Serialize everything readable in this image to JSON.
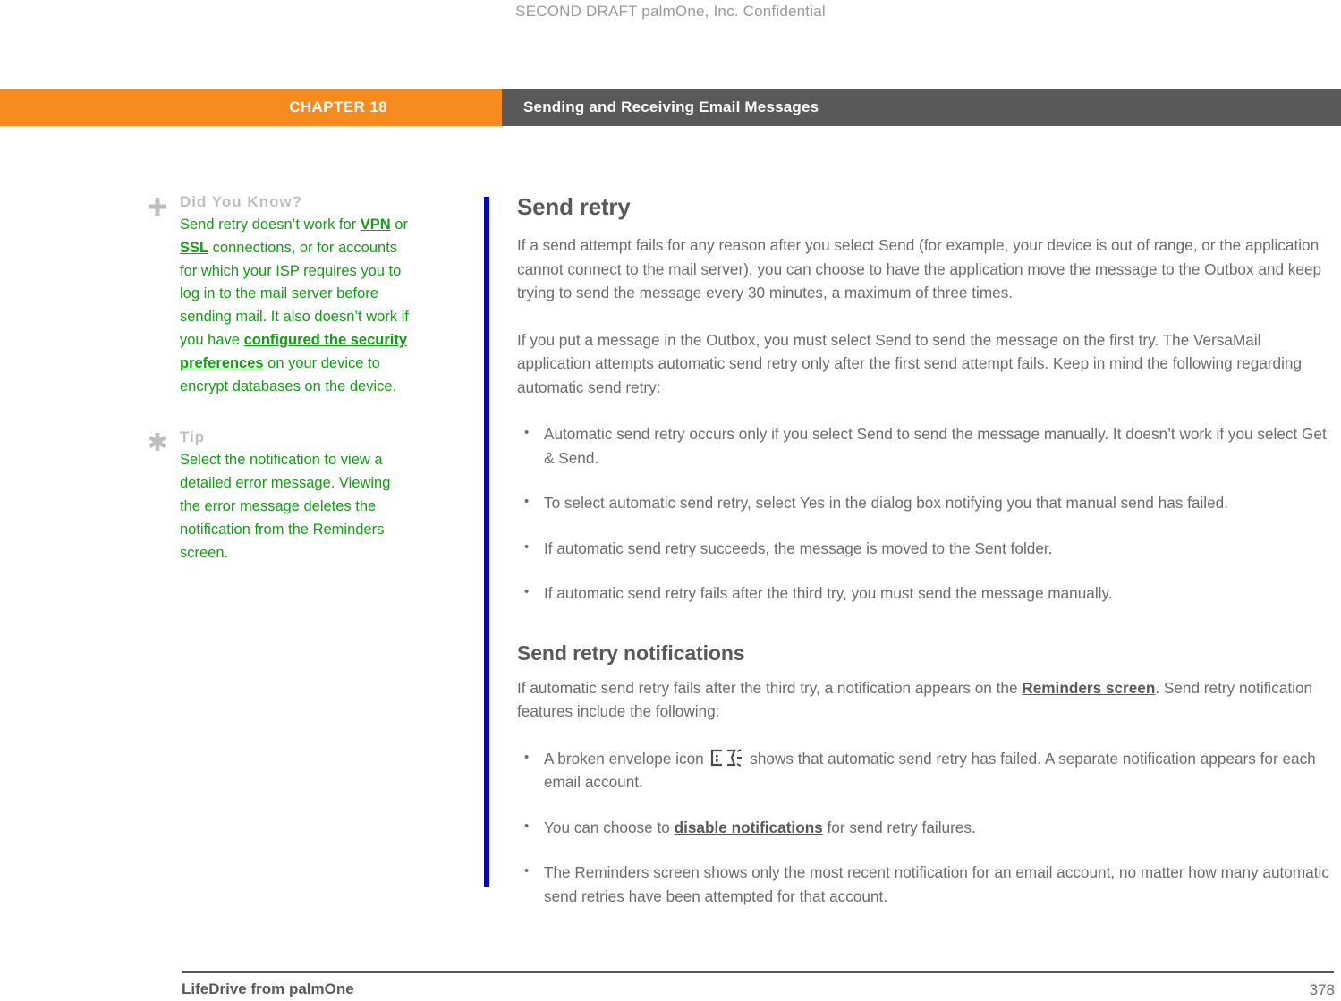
{
  "document": {
    "draft_header": "SECOND DRAFT palmOne, Inc.  Confidential",
    "accent_orange": "#f68b1f",
    "banner_gray": "#595959",
    "rule_blue": "#0000e2",
    "note_green": "#169b16",
    "body_gray": "#6b6c6e"
  },
  "banner": {
    "chapter_label": "CHAPTER 18",
    "chapter_title": "Sending and Receiving Email Messages"
  },
  "sidebar": {
    "notes": [
      {
        "icon": "plus-icon",
        "heading": "Did You Know?",
        "text_parts": [
          {
            "type": "text",
            "value": "Send retry doesn’t work for "
          },
          {
            "type": "link",
            "value": "VPN"
          },
          {
            "type": "text",
            "value": " or "
          },
          {
            "type": "link",
            "value": "SSL"
          },
          {
            "type": "text",
            "value": " connections, or for accounts for which your ISP requires you to log in to the mail server before sending mail. It also doesn’t work if you have "
          },
          {
            "type": "link",
            "value": "configured the security preferences"
          },
          {
            "type": "text",
            "value": " on your device to encrypt databases on the device."
          }
        ]
      },
      {
        "icon": "asterisk-icon",
        "heading": "Tip",
        "text_parts": [
          {
            "type": "text",
            "value": "Select the notification to view a detailed error message. Viewing the error message deletes the notification from the Reminders screen."
          }
        ]
      }
    ]
  },
  "main": {
    "section_title": "Send retry",
    "paragraph_1": "If a send attempt fails for any reason after you select Send (for example, your device is out of range, or the application cannot connect to the mail server), you can choose to have the application move the message to the Outbox and keep trying to send the message every 30 minutes, a maximum of three times.",
    "paragraph_2": "If you put a message in the Outbox, you must select Send to send the message on the first try. The VersaMail application attempts automatic send retry only after the first send attempt fails. Keep in mind the following regarding automatic send retry:",
    "bullets_1": [
      "Automatic send retry occurs only if you select Send to send the message manually. It doesn’t work if you select Get & Send.",
      "To select automatic send retry, select Yes in the dialog box notifying you that manual send has failed.",
      "If automatic send retry succeeds, the message is moved to the Sent folder.",
      "If automatic send retry fails after the third try, you must send the message manually."
    ],
    "subsection_title": "Send retry notifications",
    "paragraph_3_part_1": "If automatic send retry fails after the third try, a notification appears on the ",
    "paragraph_3_link": "Reminders screen",
    "paragraph_3_part_2": ". Send retry notification features include the following:",
    "bullet_envelope_part_1": "A broken envelope icon ",
    "bullet_envelope_icon": "broken-envelope-icon",
    "bullet_envelope_part_2": " shows that automatic send retry has failed. A separate notification appears for each email account.",
    "bullet_disable_part_1": "You can choose to ",
    "bullet_disable_link": "disable notifications",
    "bullet_disable_part_2": " for send retry failures.",
    "bullet_reminders": "The Reminders screen shows only the most recent notification for an email account, no matter how many automatic send retries have been attempted for that account."
  },
  "footer": {
    "product": "LifeDrive from palmOne",
    "page_number": "378"
  }
}
